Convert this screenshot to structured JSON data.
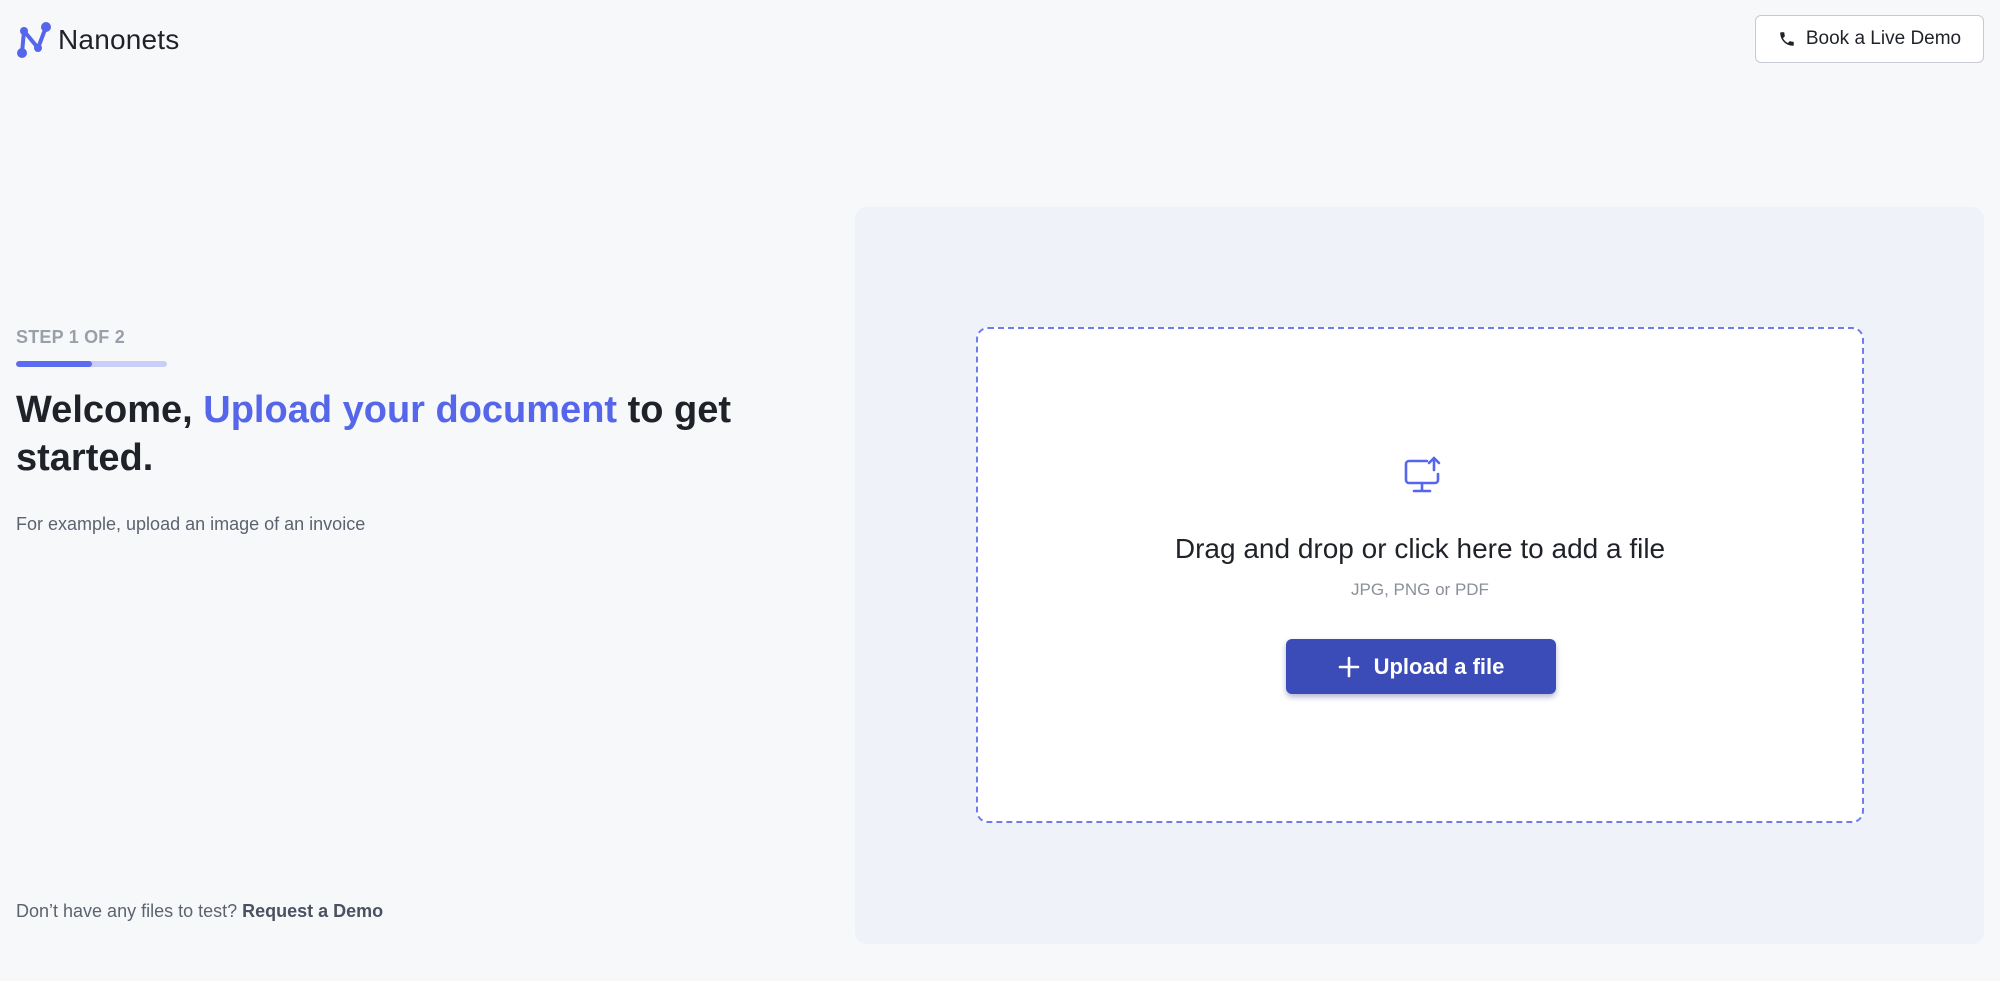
{
  "header": {
    "brand": "Nanonets",
    "demo_button_label": "Book a Live Demo"
  },
  "onboarding": {
    "step_label": "STEP 1 OF 2",
    "step_progress": 0.5,
    "headline_prefix": "Welcome, ",
    "headline_accent": "Upload your document",
    "headline_suffix": " to get started.",
    "subtext": "For example, upload an image of an invoice",
    "footer_text": "Don’t have any files to test? ",
    "footer_link": "Request a Demo"
  },
  "upload": {
    "title": "Drag and drop or click here to add a file",
    "formats": "JPG, PNG or PDF",
    "button_label": "Upload a file"
  },
  "icons": {
    "logo": "nanonets-logo-icon",
    "phone": "phone-icon",
    "upload": "monitor-upload-icon",
    "plus": "plus-icon"
  },
  "colors": {
    "accent": "#5566ea",
    "button": "#3b4cb8",
    "dropzone_border": "#6d7cf0",
    "panel_bg": "#eff2f9"
  }
}
